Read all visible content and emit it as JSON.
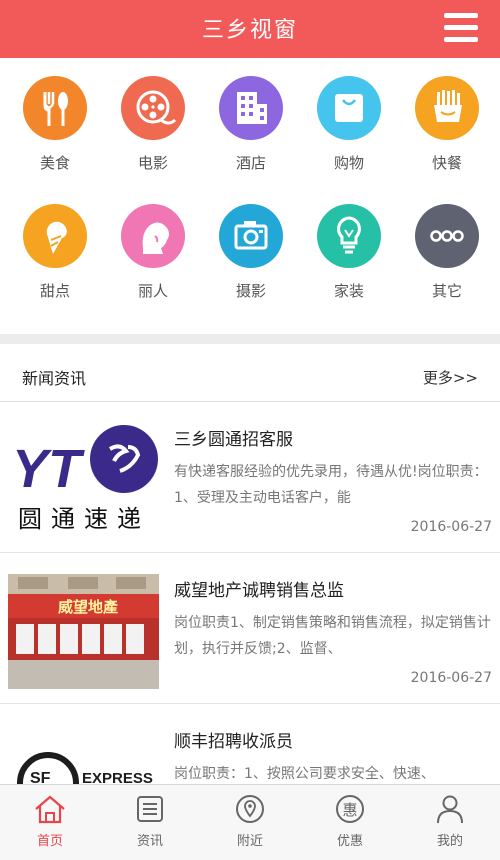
{
  "header": {
    "title": "三乡视窗",
    "menu_icon": "hamburger-menu-icon"
  },
  "categories": [
    {
      "label": "美食",
      "icon": "utensils-icon",
      "color": "#f3862a"
    },
    {
      "label": "电影",
      "icon": "film-reel-icon",
      "color": "#ef6a50"
    },
    {
      "label": "酒店",
      "icon": "hotel-building-icon",
      "color": "#8c67e0"
    },
    {
      "label": "购物",
      "icon": "shopping-bag-icon",
      "color": "#45c4ed"
    },
    {
      "label": "快餐",
      "icon": "fries-icon",
      "color": "#f5a320"
    },
    {
      "label": "甜点",
      "icon": "ice-cream-icon",
      "color": "#f5a320"
    },
    {
      "label": "丽人",
      "icon": "woman-icon",
      "color": "#f077b3"
    },
    {
      "label": "摄影",
      "icon": "camera-icon",
      "color": "#22a7d6"
    },
    {
      "label": "家装",
      "icon": "lightbulb-icon",
      "color": "#25c0a6"
    },
    {
      "label": "其它",
      "icon": "more-dots-icon",
      "color": "#5f6271"
    }
  ],
  "news": {
    "title": "新闻资讯",
    "more": "更多>>",
    "items": [
      {
        "title": "三乡圆通招客服",
        "desc": "有快递客服经验的优先录用，待遇从优!岗位职责：1、受理及主动电话客户，能",
        "date": "2016-06-27",
        "thumb": {
          "logo_text": "YT",
          "caption": "圆通速递"
        }
      },
      {
        "title": "威望地产诚聘销售总监",
        "desc": "岗位职责1、制定销售策略和销售流程，拟定销售计划，执行并反馈;2、监督、",
        "date": "2016-06-27",
        "thumb": {
          "sign_text": "威望地產"
        }
      },
      {
        "title": "顺丰招聘收派员",
        "desc": "岗位职责：1、按照公司要求安全、快速、",
        "date": "",
        "thumb": {
          "logo_text": "SF",
          "caption": "EXPRESS"
        }
      }
    ]
  },
  "tabbar": [
    {
      "label": "首页",
      "icon": "home-icon",
      "active": true
    },
    {
      "label": "资讯",
      "icon": "news-list-icon",
      "active": false
    },
    {
      "label": "附近",
      "icon": "location-pin-icon",
      "active": false
    },
    {
      "label": "优惠",
      "icon": "discount-icon",
      "active": false,
      "glyph": "惠"
    },
    {
      "label": "我的",
      "icon": "user-icon",
      "active": false
    }
  ]
}
